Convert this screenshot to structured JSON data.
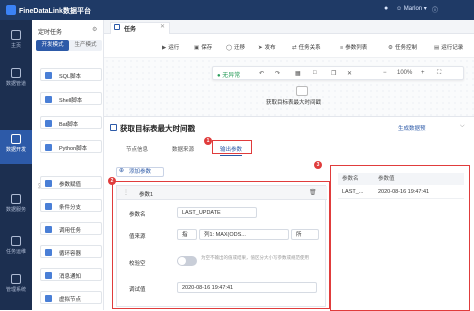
{
  "app": {
    "title": "FineDataLink数据平台",
    "user": "Marlon"
  },
  "nav": {
    "items": [
      {
        "label": "主页"
      },
      {
        "label": "数据管道"
      },
      {
        "label": "数据开发"
      },
      {
        "label": "数据服务"
      },
      {
        "label": "任务运维"
      },
      {
        "label": "管理系统"
      }
    ]
  },
  "tasks_panel": {
    "title": "定时任务",
    "mode_dev": "开发模式",
    "mode_prod": "生产模式",
    "section_flow": "流程",
    "sql_items": [
      {
        "label": "SQL脚本"
      },
      {
        "label": "Shell脚本"
      },
      {
        "label": "Bat脚本"
      },
      {
        "label": "Python脚本"
      }
    ],
    "flow_items": [
      {
        "label": "参数赋值"
      },
      {
        "label": "条件分支"
      },
      {
        "label": "调用任务"
      },
      {
        "label": "循环容器"
      },
      {
        "label": "消息通知"
      },
      {
        "label": "虚拟节点"
      }
    ]
  },
  "tab": {
    "label": "任务"
  },
  "toolbar": {
    "run": "运行",
    "save": "保存",
    "mark": "迁移",
    "publish": "发布",
    "task_config": "任务关系",
    "param_list": "参数列表",
    "task_control": "任务控制",
    "run_record": "运行记录"
  },
  "canvas": {
    "status": "无异常",
    "zoom": "100%",
    "node_label": "获取目标表最大时间戳"
  },
  "panel": {
    "title": "获取目标表最大时间戳",
    "link": "生成数据预",
    "subtabs": {
      "node_info": "节点信息",
      "data_source": "数据来源",
      "output_params": "输出参数"
    },
    "add_param": "添加参数",
    "param_header": "参数1",
    "fields": {
      "name_label": "参数名",
      "name_value": "LAST_UPDATE",
      "source_label": "值来源",
      "source_mode": "指",
      "source_column": "列1: MAX(ODS...",
      "source_extra": "所",
      "check_label": "校验空",
      "check_hint": "为空不输出的值或结果，值区分大小写参数或规范使用",
      "debug_label": "调试值",
      "debug_value": "2020-08-16 19:47:41"
    }
  },
  "result_table": {
    "headers": [
      "参数名",
      "参数值"
    ],
    "rows": [
      [
        "LAST_...",
        "2020-08-16 19:47:41"
      ]
    ]
  },
  "annotations": [
    "1",
    "2",
    "3"
  ]
}
